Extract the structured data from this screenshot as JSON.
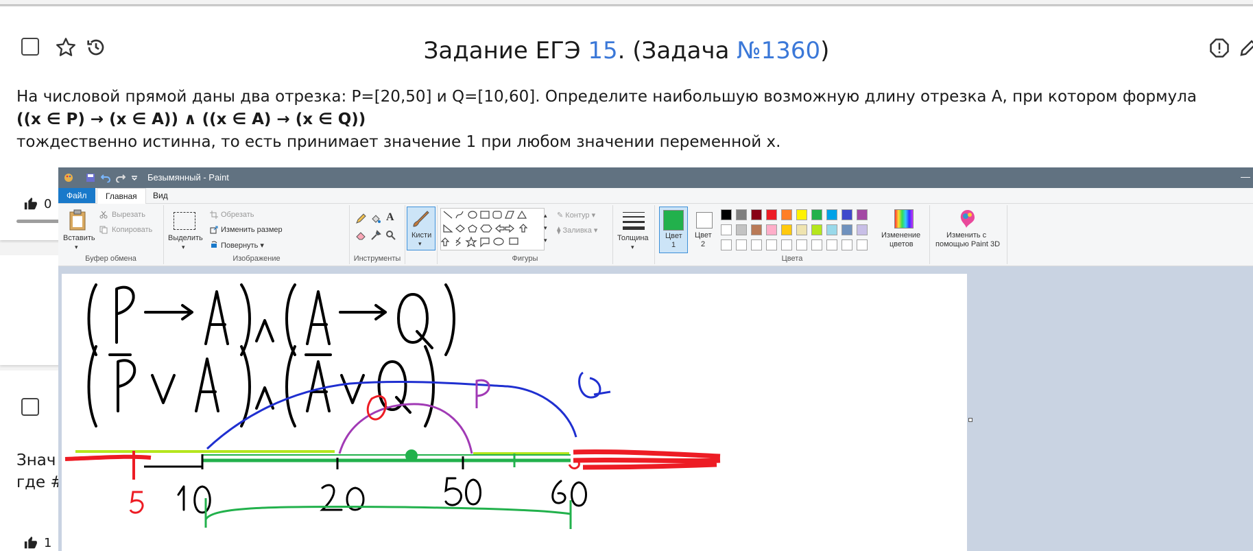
{
  "task": {
    "title_prefix": "Задание ЕГЭ ",
    "title_number": "15",
    "title_mid": ". (Задача ",
    "title_task_id": "№1360",
    "title_suffix": ")",
    "line1": "На числовой прямой даны два отрезка: P=[20,50] и Q=[10,60]. Определите наибольшую возможную длину отрезка A, при котором формула",
    "line2": "((x ∈ P) → (x ∈ A)) ∧ ((x ∈ A) → (x ∈ Q))",
    "line3": "тождественно истинна, то есть принимает значение 1 при любом значении переменной x.",
    "likes": "0"
  },
  "task2": {
    "text_line1": "Знач",
    "text_line2": "где #",
    "likes": "1"
  },
  "paint": {
    "window_title": "Безымянный - Paint",
    "menu": {
      "file": "Файл",
      "home": "Главная",
      "view": "Вид"
    },
    "clipboard": {
      "paste": "Вставить",
      "cut": "Вырезать",
      "copy": "Копировать",
      "group": "Буфер обмена"
    },
    "image": {
      "select": "Выделить",
      "crop": "Обрезать",
      "resize": "Изменить размер",
      "rotate": "Повернуть",
      "group": "Изображение"
    },
    "tools": {
      "group": "Инструменты"
    },
    "brushes": {
      "label": "Кисти"
    },
    "shapes": {
      "outline": "Контур",
      "fill": "Заливка",
      "group": "Фигуры"
    },
    "thickness": "Толщина",
    "color1": {
      "line1": "Цвет",
      "line2": "1"
    },
    "color2": {
      "line1": "Цвет",
      "line2": "2"
    },
    "edit_colors": {
      "line1": "Изменение",
      "line2": "цветов"
    },
    "paint3d": {
      "line1": "Изменить с",
      "line2": "помощью Paint 3D"
    },
    "colors_group": "Цвета",
    "palette_row1": [
      "#000000",
      "#7f7f7f",
      "#880015",
      "#ed1c24",
      "#ff7f27",
      "#fff200",
      "#22b14c",
      "#00a2e8",
      "#3f48cc",
      "#a349a4"
    ],
    "palette_row2": [
      "#ffffff",
      "#c3c3c3",
      "#b97a57",
      "#ffaec9",
      "#ffc90e",
      "#efe4b0",
      "#b5e61d",
      "#99d9ea",
      "#7092be",
      "#c8bfe7"
    ],
    "selected_color1": "#22b14c",
    "selected_color2": "#ffffff"
  },
  "drawing": {
    "formula1": "(P→A)∧(A→Q)",
    "formula2": "(P̅ ∨ A)∧(A̅ ∨ Q)",
    "label_p": "P",
    "label_q": "Q",
    "label_zero": "0",
    "ticks": [
      "5",
      "10",
      "20",
      "50",
      "60"
    ]
  }
}
